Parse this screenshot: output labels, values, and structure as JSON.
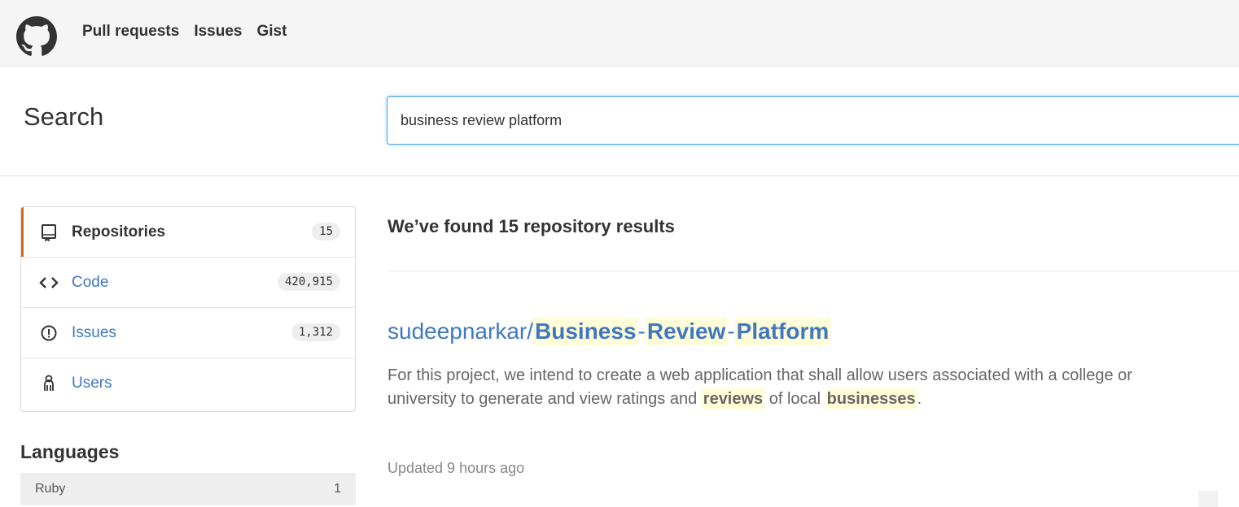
{
  "header": {
    "nav": [
      "Pull requests",
      "Issues",
      "Gist"
    ]
  },
  "search": {
    "title": "Search",
    "query": "business review platform"
  },
  "menu": {
    "items": [
      {
        "label": "Repositories",
        "count": "15",
        "icon": "repo-icon",
        "selected": true
      },
      {
        "label": "Code",
        "count": "420,915",
        "icon": "code-icon",
        "selected": false
      },
      {
        "label": "Issues",
        "count": "1,312",
        "icon": "issue-icon",
        "selected": false
      },
      {
        "label": "Users",
        "count": "",
        "icon": "person-icon",
        "selected": false
      }
    ]
  },
  "languages": {
    "title": "Languages",
    "items": [
      {
        "name": "Ruby",
        "count": "1"
      }
    ]
  },
  "results": {
    "heading": "We’ve found 15 repository results",
    "items": [
      {
        "owner": "sudeepnarkar/",
        "name_parts": [
          "Business",
          "-",
          "Review",
          "-",
          "Platform"
        ],
        "description_parts": [
          "For this project, we intend to create a web application that shall allow users associated with a college or university to generate and view ratings and ",
          "reviews",
          " of local ",
          "businesses",
          "."
        ],
        "updated": "Updated 9 hours ago"
      }
    ]
  },
  "colors": {
    "link": "#4078c0",
    "highlight": "#fffcd8",
    "selected_bar": "#d26911",
    "focus_border": "#51a7e8"
  }
}
